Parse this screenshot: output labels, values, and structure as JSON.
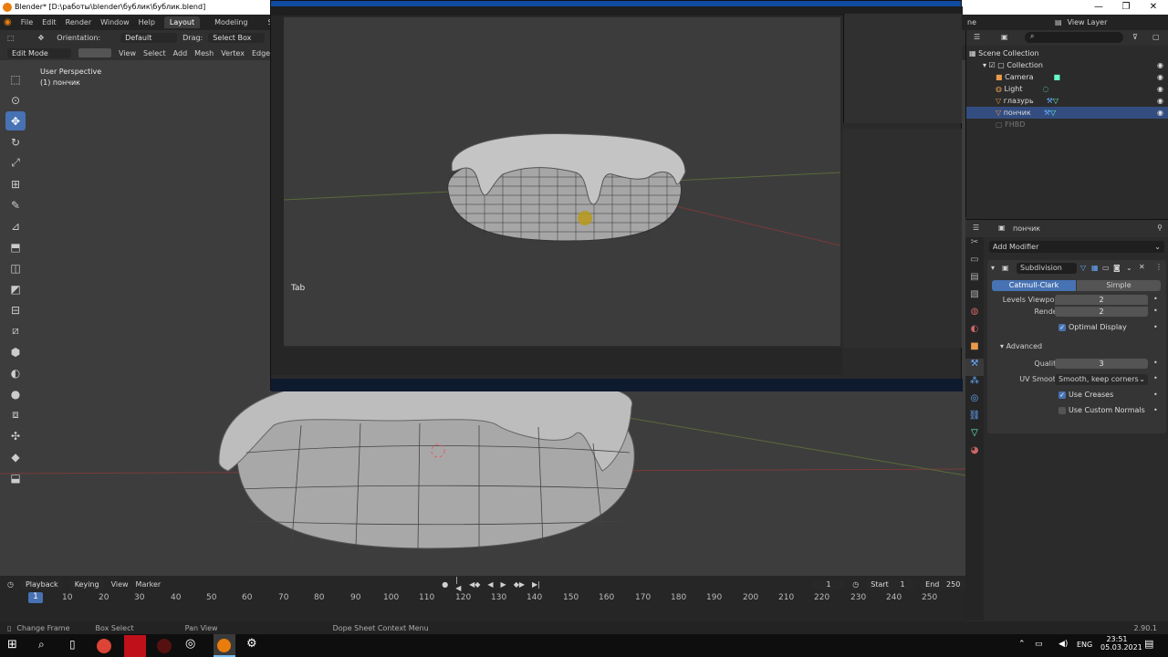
{
  "window": {
    "title": "Blender* [D:\\работы\\blender\\бублик\\бублик.blend]",
    "minimize": "—",
    "maximize": "❐",
    "close": "✕"
  },
  "menu": {
    "items": [
      "File",
      "Edit",
      "Render",
      "Window",
      "Help"
    ],
    "workspace_tabs": [
      "Layout",
      "Modeling",
      "Sculpting"
    ],
    "right_partial": "ne",
    "view_layer": "View Layer"
  },
  "tool_header": {
    "orientation_label": "Orientation:",
    "orientation_value": "Default",
    "drag_label": "Drag:",
    "drag_value": "Select Box"
  },
  "edit_header": {
    "mode": "Edit Mode",
    "menus": [
      "View",
      "Select",
      "Add",
      "Mesh",
      "Vertex",
      "Edge"
    ]
  },
  "viewport": {
    "perspective": "User Perspective",
    "object": "(1) пончик",
    "key_hint": "Tab"
  },
  "timeline": {
    "menus": [
      "Playback",
      "Keying",
      "View",
      "Marker"
    ],
    "current_frame": "1",
    "start_label": "Start",
    "start": "1",
    "end_label": "End",
    "end": "250",
    "ticks": [
      "10",
      "20",
      "30",
      "40",
      "50",
      "60",
      "70",
      "80",
      "90",
      "100",
      "110",
      "120",
      "130",
      "140",
      "150",
      "160",
      "170",
      "180",
      "190",
      "200",
      "210",
      "220",
      "230",
      "240",
      "250"
    ]
  },
  "status": {
    "change_frame": "Change Frame",
    "box_select": "Box Select",
    "pan_view": "Pan View",
    "context_menu": "Dope Sheet Context Menu",
    "version": "2.90.1"
  },
  "outliner": {
    "root": "Scene Collection",
    "collection": "Collection",
    "items": [
      "Camera",
      "Light",
      "глазурь",
      "пончик"
    ],
    "selected": "пончик",
    "extra": "FHBD"
  },
  "properties": {
    "object": "пончик",
    "add_modifier": "Add Modifier",
    "modifier_name": "Subdivision",
    "type_a": "Catmull-Clark",
    "type_b": "Simple",
    "levels_viewport_label": "Levels Viewport",
    "levels_viewport": "2",
    "render_label": "Render",
    "render": "2",
    "optimal_display": "Optimal Display",
    "advanced": "Advanced",
    "quality_label": "Quality",
    "quality": "3",
    "uv_smooth_label": "UV Smooth",
    "uv_smooth": "Smooth, keep corners",
    "use_creases": "Use Creases",
    "use_custom_normals": "Use Custom Normals"
  },
  "taskbar": {
    "lang": "ENG",
    "time": "23:51",
    "date": "05.03.2021"
  },
  "colors": {
    "accent": "#4772b3",
    "blender_orange": "#e87d0d",
    "viewport": "#3d3d3d",
    "selected_row": "#334d80"
  }
}
